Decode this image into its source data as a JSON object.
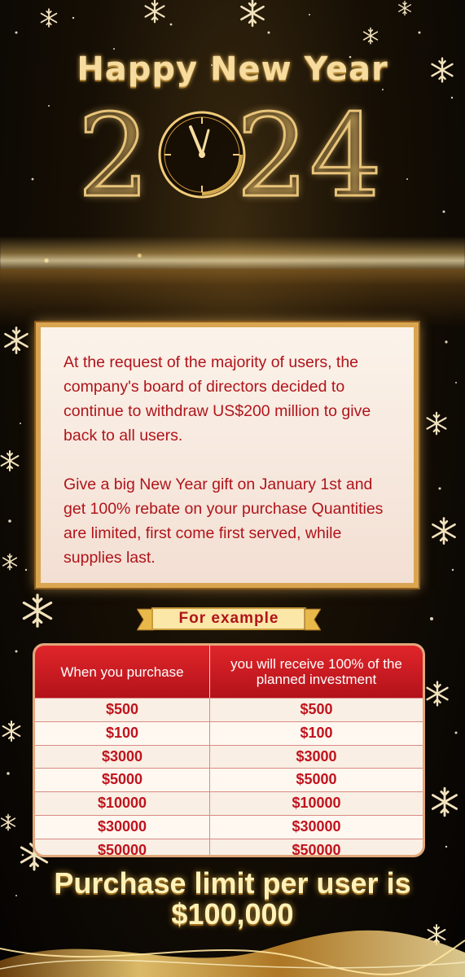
{
  "header": {
    "greeting": "Happy New Year",
    "year_digits": [
      "2",
      "2",
      "4"
    ]
  },
  "message": {
    "paragraph1": "At the request of the majority of users, the company's board of directors decided to continue to withdraw US$200 million to give back to all users.",
    "paragraph2": "Give a big New Year gift on January 1st and get 100% rebate on your purchase Quantities are limited, first come first served, while supplies last."
  },
  "banner": {
    "label": "For example"
  },
  "table": {
    "headers": [
      "When you purchase",
      "you will receive 100% of the planned investment"
    ],
    "rows": [
      [
        "$500",
        "$500"
      ],
      [
        "$100",
        "$100"
      ],
      [
        "$3000",
        "$3000"
      ],
      [
        "$5000",
        "$5000"
      ],
      [
        "$10000",
        "$10000"
      ],
      [
        "$30000",
        "$30000"
      ],
      [
        "$50000",
        "$50000"
      ]
    ]
  },
  "footer": {
    "limit_text": "Purchase limit per user is $100,000"
  },
  "colors": {
    "gold": "#e8c47a",
    "text_red": "#b0141b",
    "header_red": "#d0141c",
    "card_bg": "#fbf3ea"
  },
  "icons": [
    "snowflake-icon",
    "clock-icon",
    "sparkle-icon"
  ]
}
